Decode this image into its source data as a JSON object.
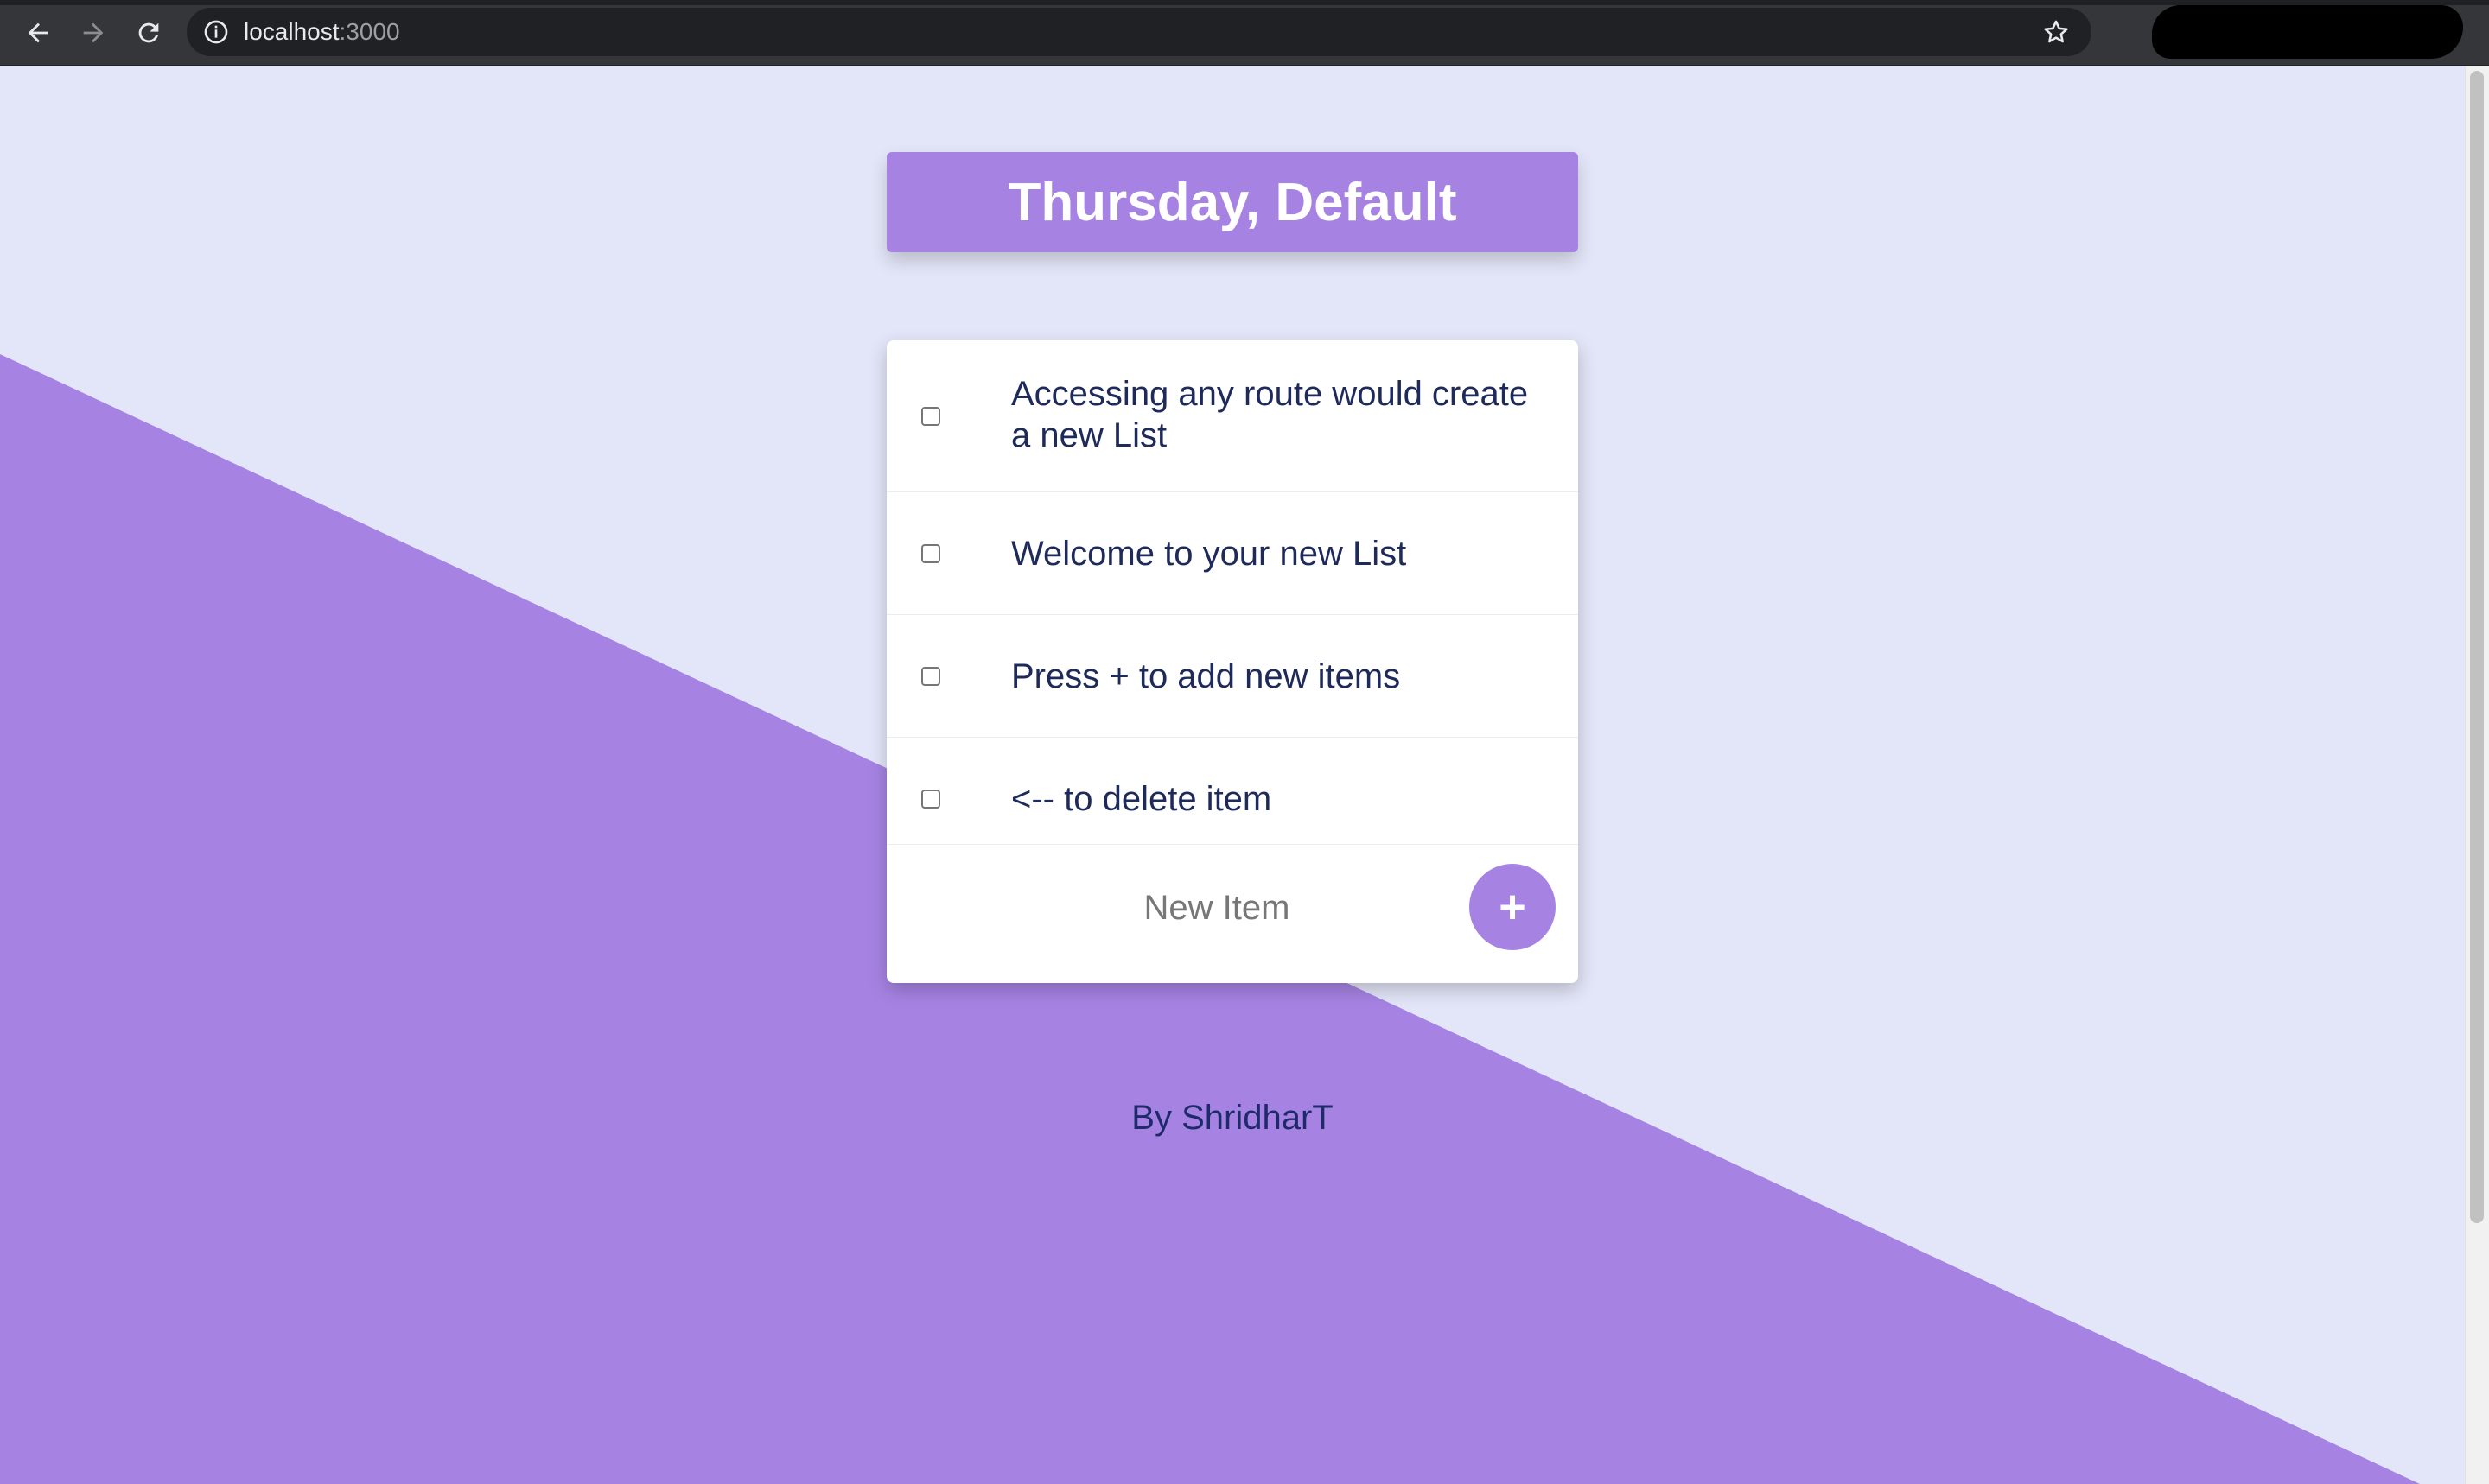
{
  "browser": {
    "url_host": "localhost",
    "url_port": ":3000",
    "icons": [
      "back-icon",
      "forward-icon",
      "reload-icon",
      "info-icon",
      "star-icon"
    ]
  },
  "page": {
    "heading": "Thursday, Default",
    "items": [
      {
        "text": "Accessing any route would create a new List",
        "checked": false
      },
      {
        "text": "Welcome to your new List",
        "checked": false
      },
      {
        "text": "Press + to add new items",
        "checked": false
      },
      {
        "text": "<-- to delete item",
        "checked": false
      }
    ],
    "new_item_placeholder": "New Item",
    "add_button_label": "+",
    "footer": "By ShridharT"
  },
  "colors": {
    "accent": "#a683e3",
    "page_background": "#e3e6f8",
    "card_background": "#ffffff",
    "text": "#1e2a5a"
  }
}
